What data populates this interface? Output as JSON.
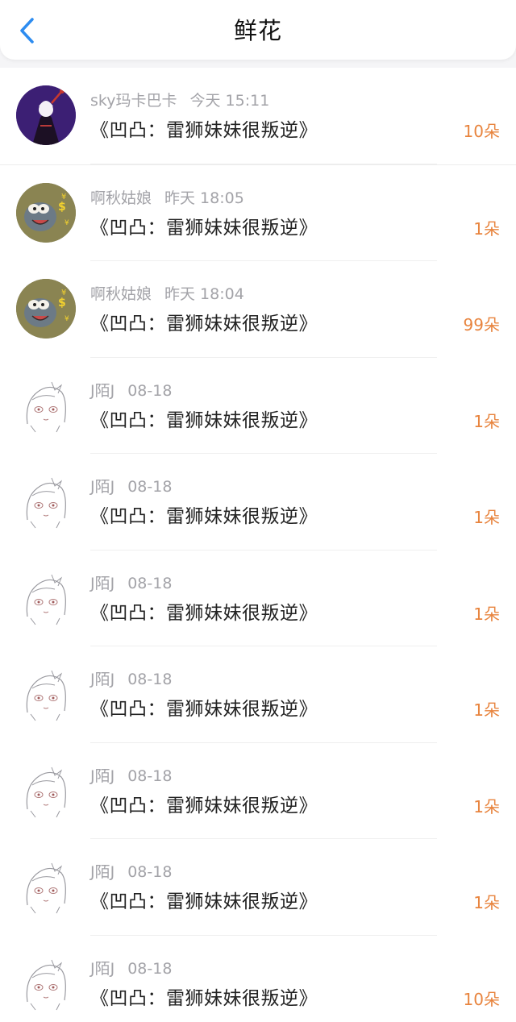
{
  "header": {
    "title": "鲜花",
    "back_icon": "chevron-left-icon",
    "accent_color": "#2d8cf0"
  },
  "colors": {
    "count": "#e8843e",
    "meta": "#a3a3a8",
    "title": "#222222"
  },
  "records": [
    {
      "user": "sky玛卡巴卡",
      "time": "今天 15:11",
      "work": "《凹凸：雷狮妹妹很叛逆》",
      "count": "10朵",
      "avatar": "purple-cloaked-figure"
    },
    {
      "user": "啊秋姑娘",
      "time": "昨天 18:05",
      "work": "《凹凸：雷狮妹妹很叛逆》",
      "count": "1朵",
      "avatar": "cartoon-cat-money"
    },
    {
      "user": "啊秋姑娘",
      "time": "昨天 18:04",
      "work": "《凹凸：雷狮妹妹很叛逆》",
      "count": "99朵",
      "avatar": "cartoon-cat-money"
    },
    {
      "user": "J陌J",
      "time": "08-18",
      "work": "《凹凸：雷狮妹妹很叛逆》",
      "count": "1朵",
      "avatar": "anime-girl-sketch"
    },
    {
      "user": "J陌J",
      "time": "08-18",
      "work": "《凹凸：雷狮妹妹很叛逆》",
      "count": "1朵",
      "avatar": "anime-girl-sketch"
    },
    {
      "user": "J陌J",
      "time": "08-18",
      "work": "《凹凸：雷狮妹妹很叛逆》",
      "count": "1朵",
      "avatar": "anime-girl-sketch"
    },
    {
      "user": "J陌J",
      "time": "08-18",
      "work": "《凹凸：雷狮妹妹很叛逆》",
      "count": "1朵",
      "avatar": "anime-girl-sketch"
    },
    {
      "user": "J陌J",
      "time": "08-18",
      "work": "《凹凸：雷狮妹妹很叛逆》",
      "count": "1朵",
      "avatar": "anime-girl-sketch"
    },
    {
      "user": "J陌J",
      "time": "08-18",
      "work": "《凹凸：雷狮妹妹很叛逆》",
      "count": "1朵",
      "avatar": "anime-girl-sketch"
    },
    {
      "user": "J陌J",
      "time": "08-18",
      "work": "《凹凸：雷狮妹妹很叛逆》",
      "count": "10朵",
      "avatar": "anime-girl-sketch"
    }
  ]
}
